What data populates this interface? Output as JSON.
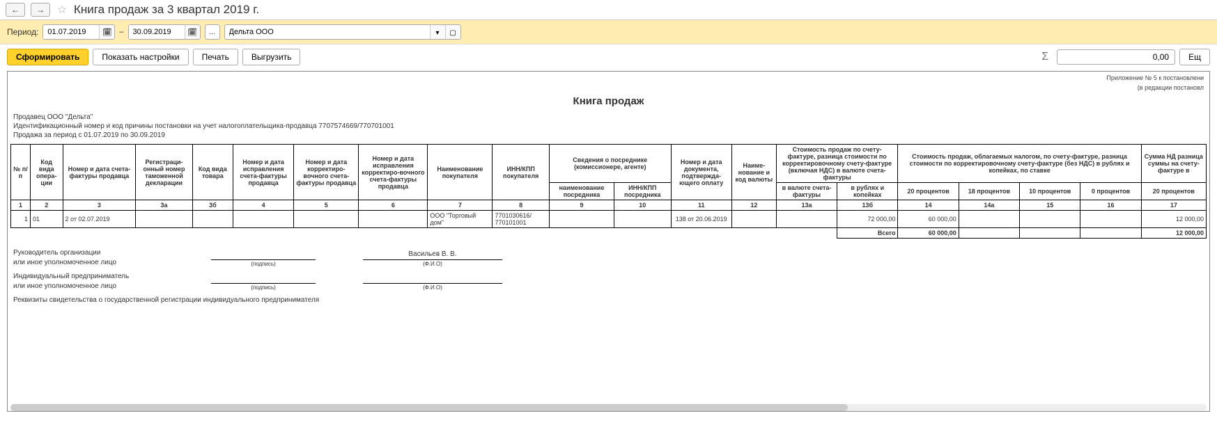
{
  "header": {
    "title": "Книга продаж за 3 квартал 2019 г."
  },
  "period": {
    "label": "Период:",
    "from": "01.07.2019",
    "dash": "–",
    "to": "30.09.2019",
    "ellipsis": "...",
    "org": "Дельта ООО"
  },
  "actions": {
    "form": "Сформировать",
    "show_settings": "Показать настройки",
    "print": "Печать",
    "export": "Выгрузить",
    "sum_value": "0,00",
    "more": "Ещ"
  },
  "report": {
    "annex1": "Приложение № 5 к постановлени",
    "annex2": "(в редакции постановл",
    "title": "Книга продаж",
    "seller_line": "Продавец  ООО \"Дельта\"",
    "inn_line": "Идентификационный номер и код причины постановки на учет налогоплательщика-продавца  7707574669/770701001",
    "period_line": "Продажа за период с 01.07.2019 по 30.09.2019"
  },
  "table": {
    "headers": {
      "c1": "№ п/п",
      "c2": "Код вида опера-ции",
      "c3": "Номер и дата счета-фактуры продавца",
      "c3a": "Регистраци-онный номер таможенной декларации",
      "c3b": "Код вида товара",
      "c4": "Номер и дата исправления счета-фактуры продавца",
      "c5": "Номер и дата корректиро-вочного счета-фактуры продавца",
      "c6": "Номер и дата исправления корректиро-вочного счета-фактуры продавца",
      "c7": "Наименование покупателя",
      "c8": "ИНН/КПП покупателя",
      "c9_10": "Сведения о посреднике (комиссионере, агенте)",
      "c9": "наименование посредника",
      "c10": "ИНН/КПП посредника",
      "c11": "Номер и дата документа, подтвержда-ющего оплату",
      "c12": "Наиме-нование и код валюты",
      "c13": "Стоимость продаж по счету-фактуре, разница стоимости по корректировочному счету-фактуре (включая НДС) в валюте счета-фактуры",
      "c13a": "в валюте счета-фактуры",
      "c13b": "в рублях и копейках",
      "c14_16": "Стоимость продаж, облагаемых налогом, по счету-фактуре, разница стоимости по корректировочному счету-фактуре (без НДС) в рублях и копейках, по ставке",
      "c14": "20 процентов",
      "c14a": "18 процентов",
      "c15": "10 процентов",
      "c16": "0 процентов",
      "c17g": "Сумма НД разница суммы на счету-фактуре в",
      "c17": "20 процентов"
    },
    "colnums": {
      "n1": "1",
      "n2": "2",
      "n3": "3",
      "n3a": "3а",
      "n3b": "3б",
      "n4": "4",
      "n5": "5",
      "n6": "6",
      "n7": "7",
      "n8": "8",
      "n9": "9",
      "n10": "10",
      "n11": "11",
      "n12": "12",
      "n13a": "13а",
      "n13b": "13б",
      "n14": "14",
      "n14a": "14а",
      "n15": "15",
      "n16": "16",
      "n17": "17"
    },
    "rows": [
      {
        "num": "1",
        "op_code": "01",
        "sf": "2 от 02.07.2019",
        "c3a": "",
        "c3b": "",
        "c4": "",
        "c5": "",
        "c6": "",
        "buyer": "ООО \"Торговый дом\"",
        "inn_kpp": "7701030616/ 770101001",
        "c9": "",
        "c10": "",
        "pay_doc": "138 от 20.06.2019",
        "c12": "",
        "c13a": "",
        "c13b": "72 000,00",
        "c14": "60 000,00",
        "c14a": "",
        "c15": "",
        "c16": "",
        "c17": "12 000,00"
      }
    ],
    "total_label": "Всего",
    "totals": {
      "c14": "60 000,00",
      "c14a": "",
      "c15": "",
      "c16": "",
      "c17": "12 000,00"
    }
  },
  "signatures": {
    "head_label": "Руководитель организации",
    "or_auth": "или иное уполномоченное лицо",
    "sign_caption": "(подпись)",
    "fio_caption": "(Ф.И.О)",
    "head_name": "Васильев В. В.",
    "ip_label": "Индивидуальный предприниматель",
    "reg_info": "Реквизиты свидетельства о государственной регистрации индивидуального предпринимателя"
  }
}
